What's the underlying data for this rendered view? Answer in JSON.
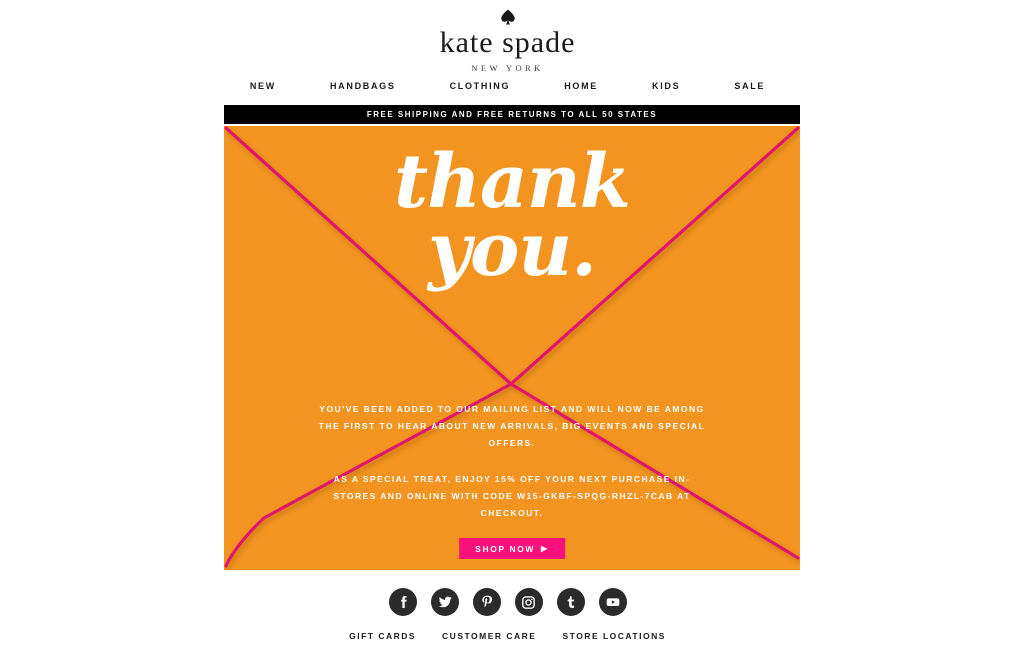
{
  "brand": {
    "name": "kate spade",
    "sub": "NEW YORK",
    "spade_icon": "spade-icon"
  },
  "nav": {
    "items": [
      {
        "label": "NEW"
      },
      {
        "label": "HANDBAGS"
      },
      {
        "label": "CLOTHING"
      },
      {
        "label": "HOME"
      },
      {
        "label": "KIDS"
      },
      {
        "label": "SALE"
      }
    ]
  },
  "promo_banner": {
    "text": "FREE SHIPPING AND FREE RETURNS TO ALL 50 STATES"
  },
  "hero": {
    "headline_line1": "thank",
    "headline_line2": "you.",
    "paragraph1": "YOU'VE BEEN ADDED TO OUR MAILING LIST AND WILL NOW BE AMONG THE FIRST TO HEAR ABOUT NEW ARRIVALS, BIG EVENTS AND SPECIAL OFFERS.",
    "paragraph2": "AS A SPECIAL TREAT, ENJOY 15% OFF YOUR NEXT PURCHASE IN-STORES AND ONLINE WITH CODE W15-GKBF-SPQG-RHZL-7CAB AT CHECKOUT.",
    "promo_code": "W15-GKBF-SPQG-RHZL-7CAB",
    "discount": "15% OFF",
    "cta_label": "SHOP NOW",
    "cta_arrow": "▶",
    "background_color": "#f2941f",
    "line_color": "#e0156c",
    "cta_color": "#fb0f7c"
  },
  "social": {
    "items": [
      {
        "name": "facebook-icon",
        "glyph": "f"
      },
      {
        "name": "twitter-icon",
        "glyph": "t"
      },
      {
        "name": "pinterest-icon",
        "glyph": "P"
      },
      {
        "name": "instagram-icon",
        "glyph": "ig"
      },
      {
        "name": "tumblr-icon",
        "glyph": "t"
      },
      {
        "name": "youtube-icon",
        "glyph": "y"
      }
    ]
  },
  "footer": {
    "links": [
      {
        "label": "GIFT CARDS"
      },
      {
        "label": "CUSTOMER CARE"
      },
      {
        "label": "STORE LOCATIONS"
      }
    ]
  }
}
